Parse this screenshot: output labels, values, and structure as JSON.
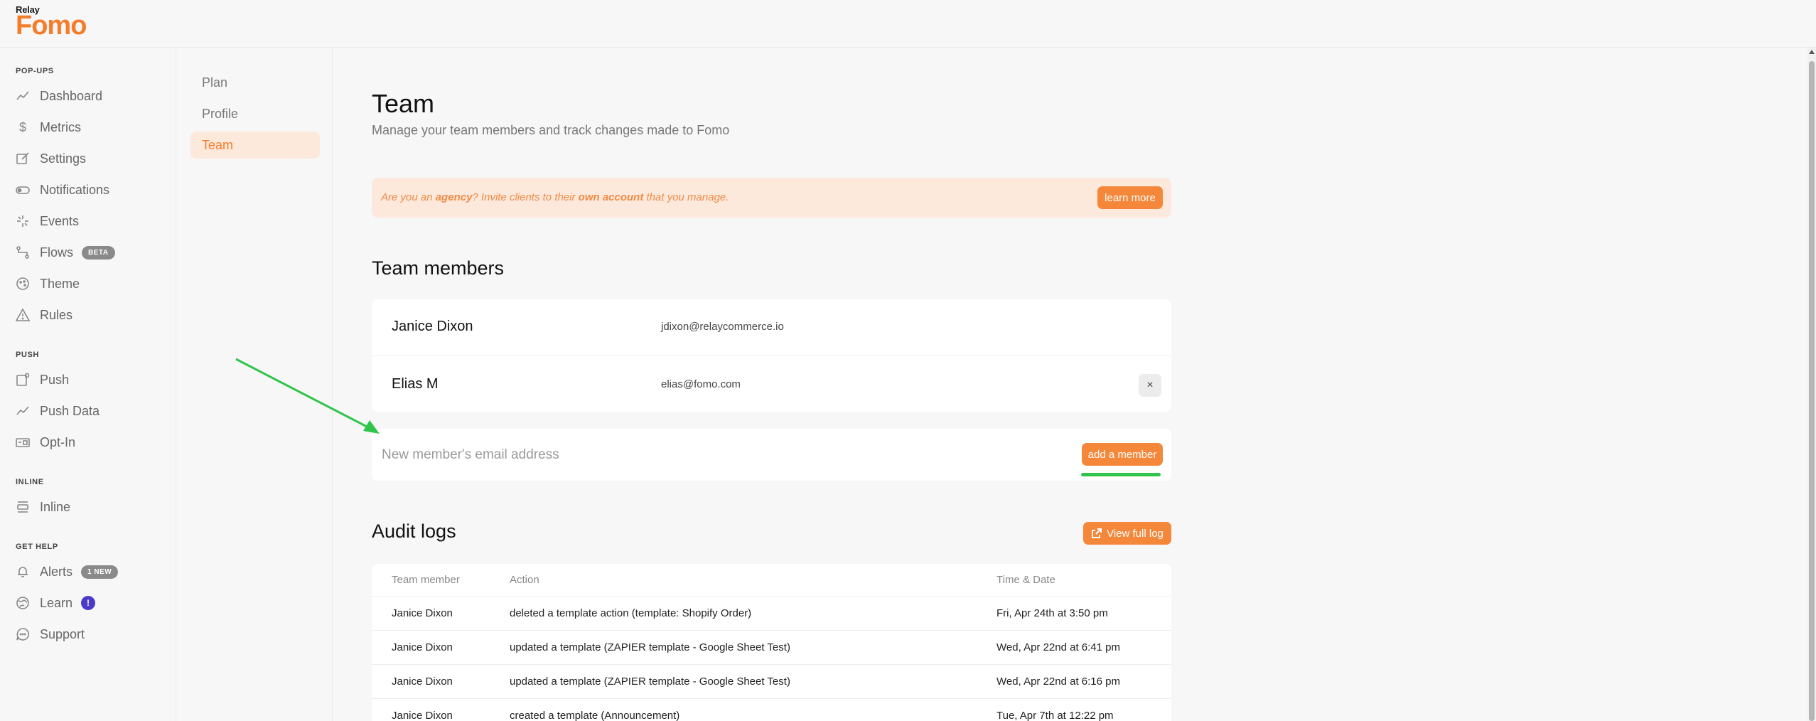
{
  "brand": {
    "relay": "Relay",
    "fomo": "Fomo"
  },
  "sidebar": {
    "sections": [
      {
        "label": "POP-UPS"
      },
      {
        "label": "PUSH"
      },
      {
        "label": "INLINE"
      },
      {
        "label": "GET HELP"
      }
    ],
    "items": [
      {
        "label": "Dashboard",
        "icon": "chart-line-icon"
      },
      {
        "label": "Metrics",
        "icon": "dollar-icon"
      },
      {
        "label": "Settings",
        "icon": "edit-icon"
      },
      {
        "label": "Notifications",
        "icon": "toggle-icon"
      },
      {
        "label": "Events",
        "icon": "spark-icon"
      },
      {
        "label": "Flows",
        "icon": "flow-icon",
        "badge": "BETA"
      },
      {
        "label": "Theme",
        "icon": "palette-icon"
      },
      {
        "label": "Rules",
        "icon": "warning-icon"
      },
      {
        "label": "Push",
        "icon": "push-icon"
      },
      {
        "label": "Push Data",
        "icon": "chart-line-icon"
      },
      {
        "label": "Opt-In",
        "icon": "optin-icon"
      },
      {
        "label": "Inline",
        "icon": "inline-icon"
      },
      {
        "label": "Alerts",
        "icon": "bell-icon",
        "badge": "1 NEW"
      },
      {
        "label": "Learn",
        "icon": "globe-icon",
        "badge": "!"
      },
      {
        "label": "Support",
        "icon": "chat-icon"
      }
    ]
  },
  "subnav": {
    "items": [
      {
        "label": "Plan"
      },
      {
        "label": "Profile"
      },
      {
        "label": "Team",
        "active": true
      }
    ]
  },
  "page": {
    "title": "Team",
    "subtitle": "Manage your team members and track changes made to Fomo"
  },
  "agency": {
    "part1": "Are you an ",
    "bold1": "agency",
    "part2": "? Invite clients to their ",
    "bold2": "own account",
    "part3": " that you manage.",
    "button": "learn more"
  },
  "team": {
    "heading": "Team members",
    "members": [
      {
        "name": "Janice Dixon",
        "email": "jdixon@relaycommerce.io"
      },
      {
        "name": "Elias M",
        "email": "elias@fomo.com"
      }
    ],
    "remove_icon": "×",
    "add_placeholder": "New member's email address",
    "add_button": "add a member"
  },
  "audit": {
    "heading": "Audit logs",
    "view_button": "View full log",
    "columns": [
      "Team member",
      "Action",
      "Time & Date"
    ],
    "rows": [
      [
        "Janice Dixon",
        "deleted a template action (template: Shopify Order)",
        "Fri, Apr 24th at 3:50 pm"
      ],
      [
        "Janice Dixon",
        "updated a template (ZAPIER template - Google Sheet Test)",
        "Wed, Apr 22nd at 6:41 pm"
      ],
      [
        "Janice Dixon",
        "updated a template (ZAPIER template - Google Sheet Test)",
        "Wed, Apr 22nd at 6:16 pm"
      ],
      [
        "Janice Dixon",
        "created a template (Announcement)",
        "Tue, Apr 7th at 12:22 pm"
      ]
    ]
  },
  "colors": {
    "accent": "#f4873a",
    "accent_soft": "#fde9dc",
    "arrow": "#2fc44a",
    "badge_purple": "#4a3bc7"
  }
}
